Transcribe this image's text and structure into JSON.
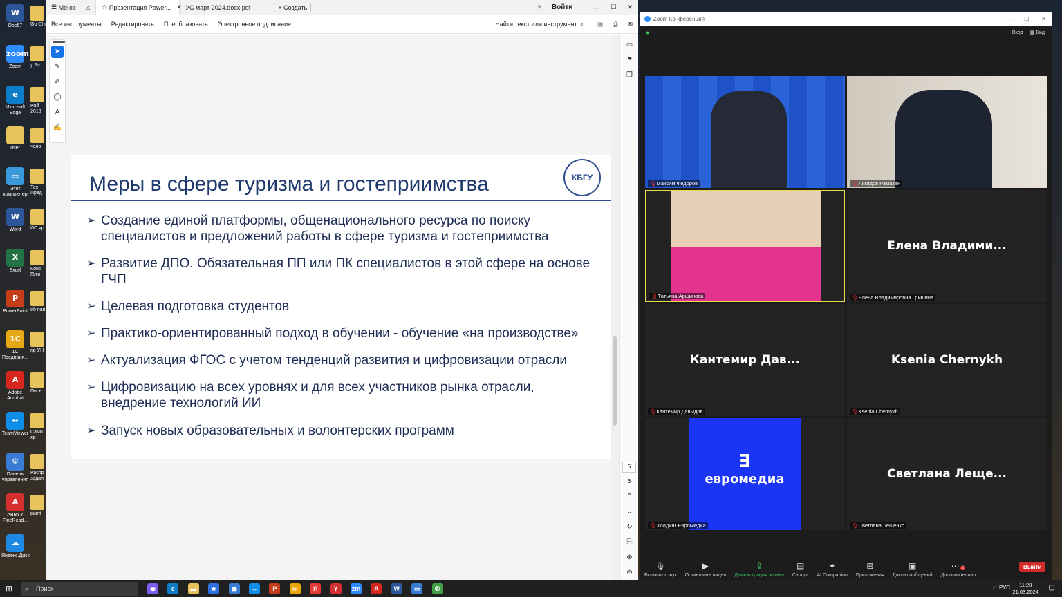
{
  "desktop": {
    "icons": [
      {
        "label": "Doc67",
        "glyph": "W",
        "color": "#2b579a"
      },
      {
        "label": "Zoom",
        "glyph": "zoom",
        "color": "#2d8cff"
      },
      {
        "label": "Microsoft Edge",
        "glyph": "e",
        "color": "#0c7dc7"
      },
      {
        "label": "user",
        "glyph": "",
        "color": "#e8c25a"
      },
      {
        "label": "Этот компьютер",
        "glyph": "▭",
        "color": "#3a9ad9"
      },
      {
        "label": "Word",
        "glyph": "W",
        "color": "#2b579a"
      },
      {
        "label": "Excel",
        "glyph": "X",
        "color": "#217346"
      },
      {
        "label": "PowerPoint",
        "glyph": "P",
        "color": "#c43e1c"
      },
      {
        "label": "1С Предприя...",
        "glyph": "1С",
        "color": "#e6a817"
      },
      {
        "label": "Adobe Acrobat",
        "glyph": "A",
        "color": "#d7261e"
      },
      {
        "label": "TeamViewer",
        "glyph": "↔",
        "color": "#0e8ee9"
      },
      {
        "label": "Панель управления",
        "glyph": "⚙",
        "color": "#3a7bd5"
      },
      {
        "label": "ABBYY FineRead...",
        "glyph": "A",
        "color": "#d32f2f"
      },
      {
        "label": "Яндекс.Диск",
        "glyph": "☁",
        "color": "#1e88e5"
      }
    ],
    "icons2": [
      "Go Chr",
      "у Ра",
      "Раб 2018",
      "чело",
      "Тех Пред",
      "ИС яр",
      "Конс Плю",
      "об пап",
      "пр УН",
      "Пись",
      "Само яр",
      "Распр задан",
      "paint"
    ]
  },
  "acrobat": {
    "menu": "Меню",
    "tab1": "Презентация Power...",
    "tab2": "УС март 2024.docx.pdf",
    "new_tab": "+ Создать",
    "login": "Войти",
    "tools": [
      "Все инструменты",
      "Редактировать",
      "Преобразовать",
      "Электронное подписание"
    ],
    "search": "Найти текст или инструмент",
    "page_current": "5",
    "page_total": "6"
  },
  "slide": {
    "title": "Меры в сфере туризма и гостеприимства",
    "logo": "КБГУ",
    "bullets": [
      "Создание единой платформы, общенационального ресурса по поиску специалистов и предложений работы в сфере туризма и гостеприимства",
      "Развитие ДПО. Обязательная ПП или ПК специалистов в этой сфере на основе ГЧП",
      "Целевая подготовка студентов",
      "Практико-ориентированный подход в обучении - обучение «на производстве»",
      "Актуализация ФГОС с учетом тенденций развития и цифровизации отрасли",
      "Цифровизацию на всех уровнях и для всех участников рынка отрасли, внедрение  технологий ИИ",
      "Запуск новых образовательных и волонтерских программ"
    ]
  },
  "zoom": {
    "title": "Zoom Конференция",
    "top_right": [
      "Вход",
      "Вид"
    ],
    "tiles": [
      {
        "name": "Максим Федоров",
        "big": "",
        "video": "euromedia"
      },
      {
        "name": "Лигидов Рамазан",
        "big": "",
        "video": "office"
      },
      {
        "name": "Татьяна Аршинова",
        "big": "",
        "video": "pink"
      },
      {
        "name": "Елена Владимировна Гришина",
        "big": "Елена  Владими..."
      },
      {
        "name": "Кантемир Давыдов",
        "big": "Кантемир  Дав..."
      },
      {
        "name": "Ksenia Chernykh",
        "big": "Ksenia Chernykh"
      },
      {
        "name": "Холдинг ЕвроМедиа",
        "big": "",
        "video": "logo",
        "logo_text": "евромедиа"
      },
      {
        "name": "Светлана Лещенко",
        "big": "Светлана  Леще..."
      }
    ],
    "toolbar": [
      "Включить звук",
      "Остановить видео",
      "Демонстрация экрана",
      "Сводка",
      "AI Companion",
      "Приложения",
      "Доски сообщений",
      "Дополнительно"
    ],
    "leave": "Выйти",
    "badge": "2"
  },
  "taskbar": {
    "search": "Поиск",
    "lang": "РУС",
    "time": "11:28",
    "date": "21.03.2024"
  }
}
